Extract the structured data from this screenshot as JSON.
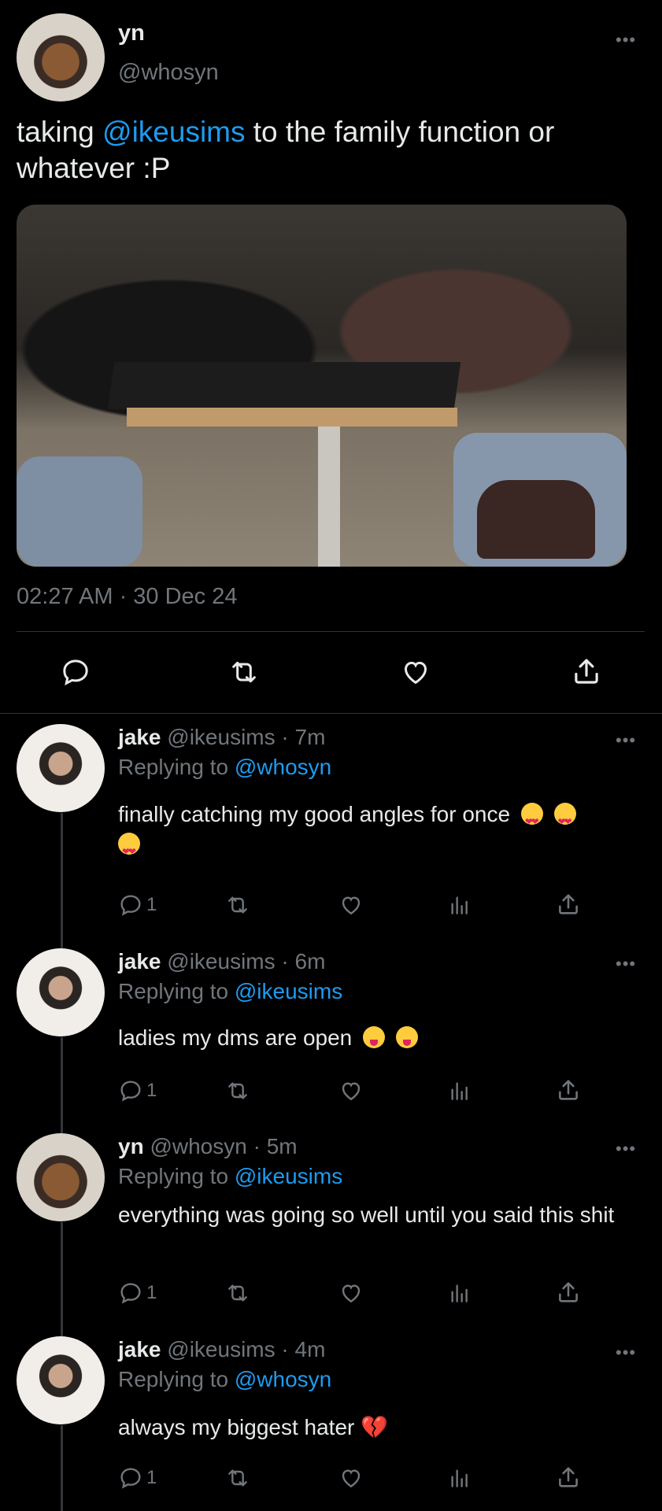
{
  "main_tweet": {
    "name": "yn",
    "handle": "@whosyn",
    "text_pre": "taking ",
    "mention": "@ikeusims",
    "text_post": " to the family function or whatever :P",
    "timestamp": "02:27 AM · 30 Dec 24",
    "icons": [
      "reply-icon",
      "retweet-icon",
      "like-icon",
      "share-icon"
    ]
  },
  "replies": [
    {
      "name": "jake",
      "handle": "@ikeusims",
      "time": "· 7m",
      "replying_prefix": "Replying to ",
      "replying_to": "@whosyn",
      "text": "finally catching my good angles for once",
      "emoji": "😍 😍 😍",
      "reply_count": "1"
    },
    {
      "name": "jake",
      "handle": "@ikeusims",
      "time": "· 6m",
      "replying_prefix": "Replying to ",
      "replying_to": "@ikeusims",
      "text": "ladies my dms are open",
      "emoji": "😝 😝",
      "reply_count": "1"
    },
    {
      "name": "yn",
      "handle": "@whosyn",
      "time": "· 5m",
      "replying_prefix": "Replying to ",
      "replying_to": "@ikeusims",
      "text": "everything was going so well until you said this shit",
      "reply_count": "1"
    },
    {
      "name": "jake",
      "handle": "@ikeusims",
      "time": "· 4m",
      "replying_prefix": "Replying to ",
      "replying_to": "@whosyn",
      "text": "always my biggest hater",
      "emoji": "💔",
      "reply_count": "1"
    }
  ],
  "colors": {
    "background": "#000000",
    "text": "#e7e9ea",
    "muted": "#71767b",
    "link": "#1d9bf0"
  }
}
